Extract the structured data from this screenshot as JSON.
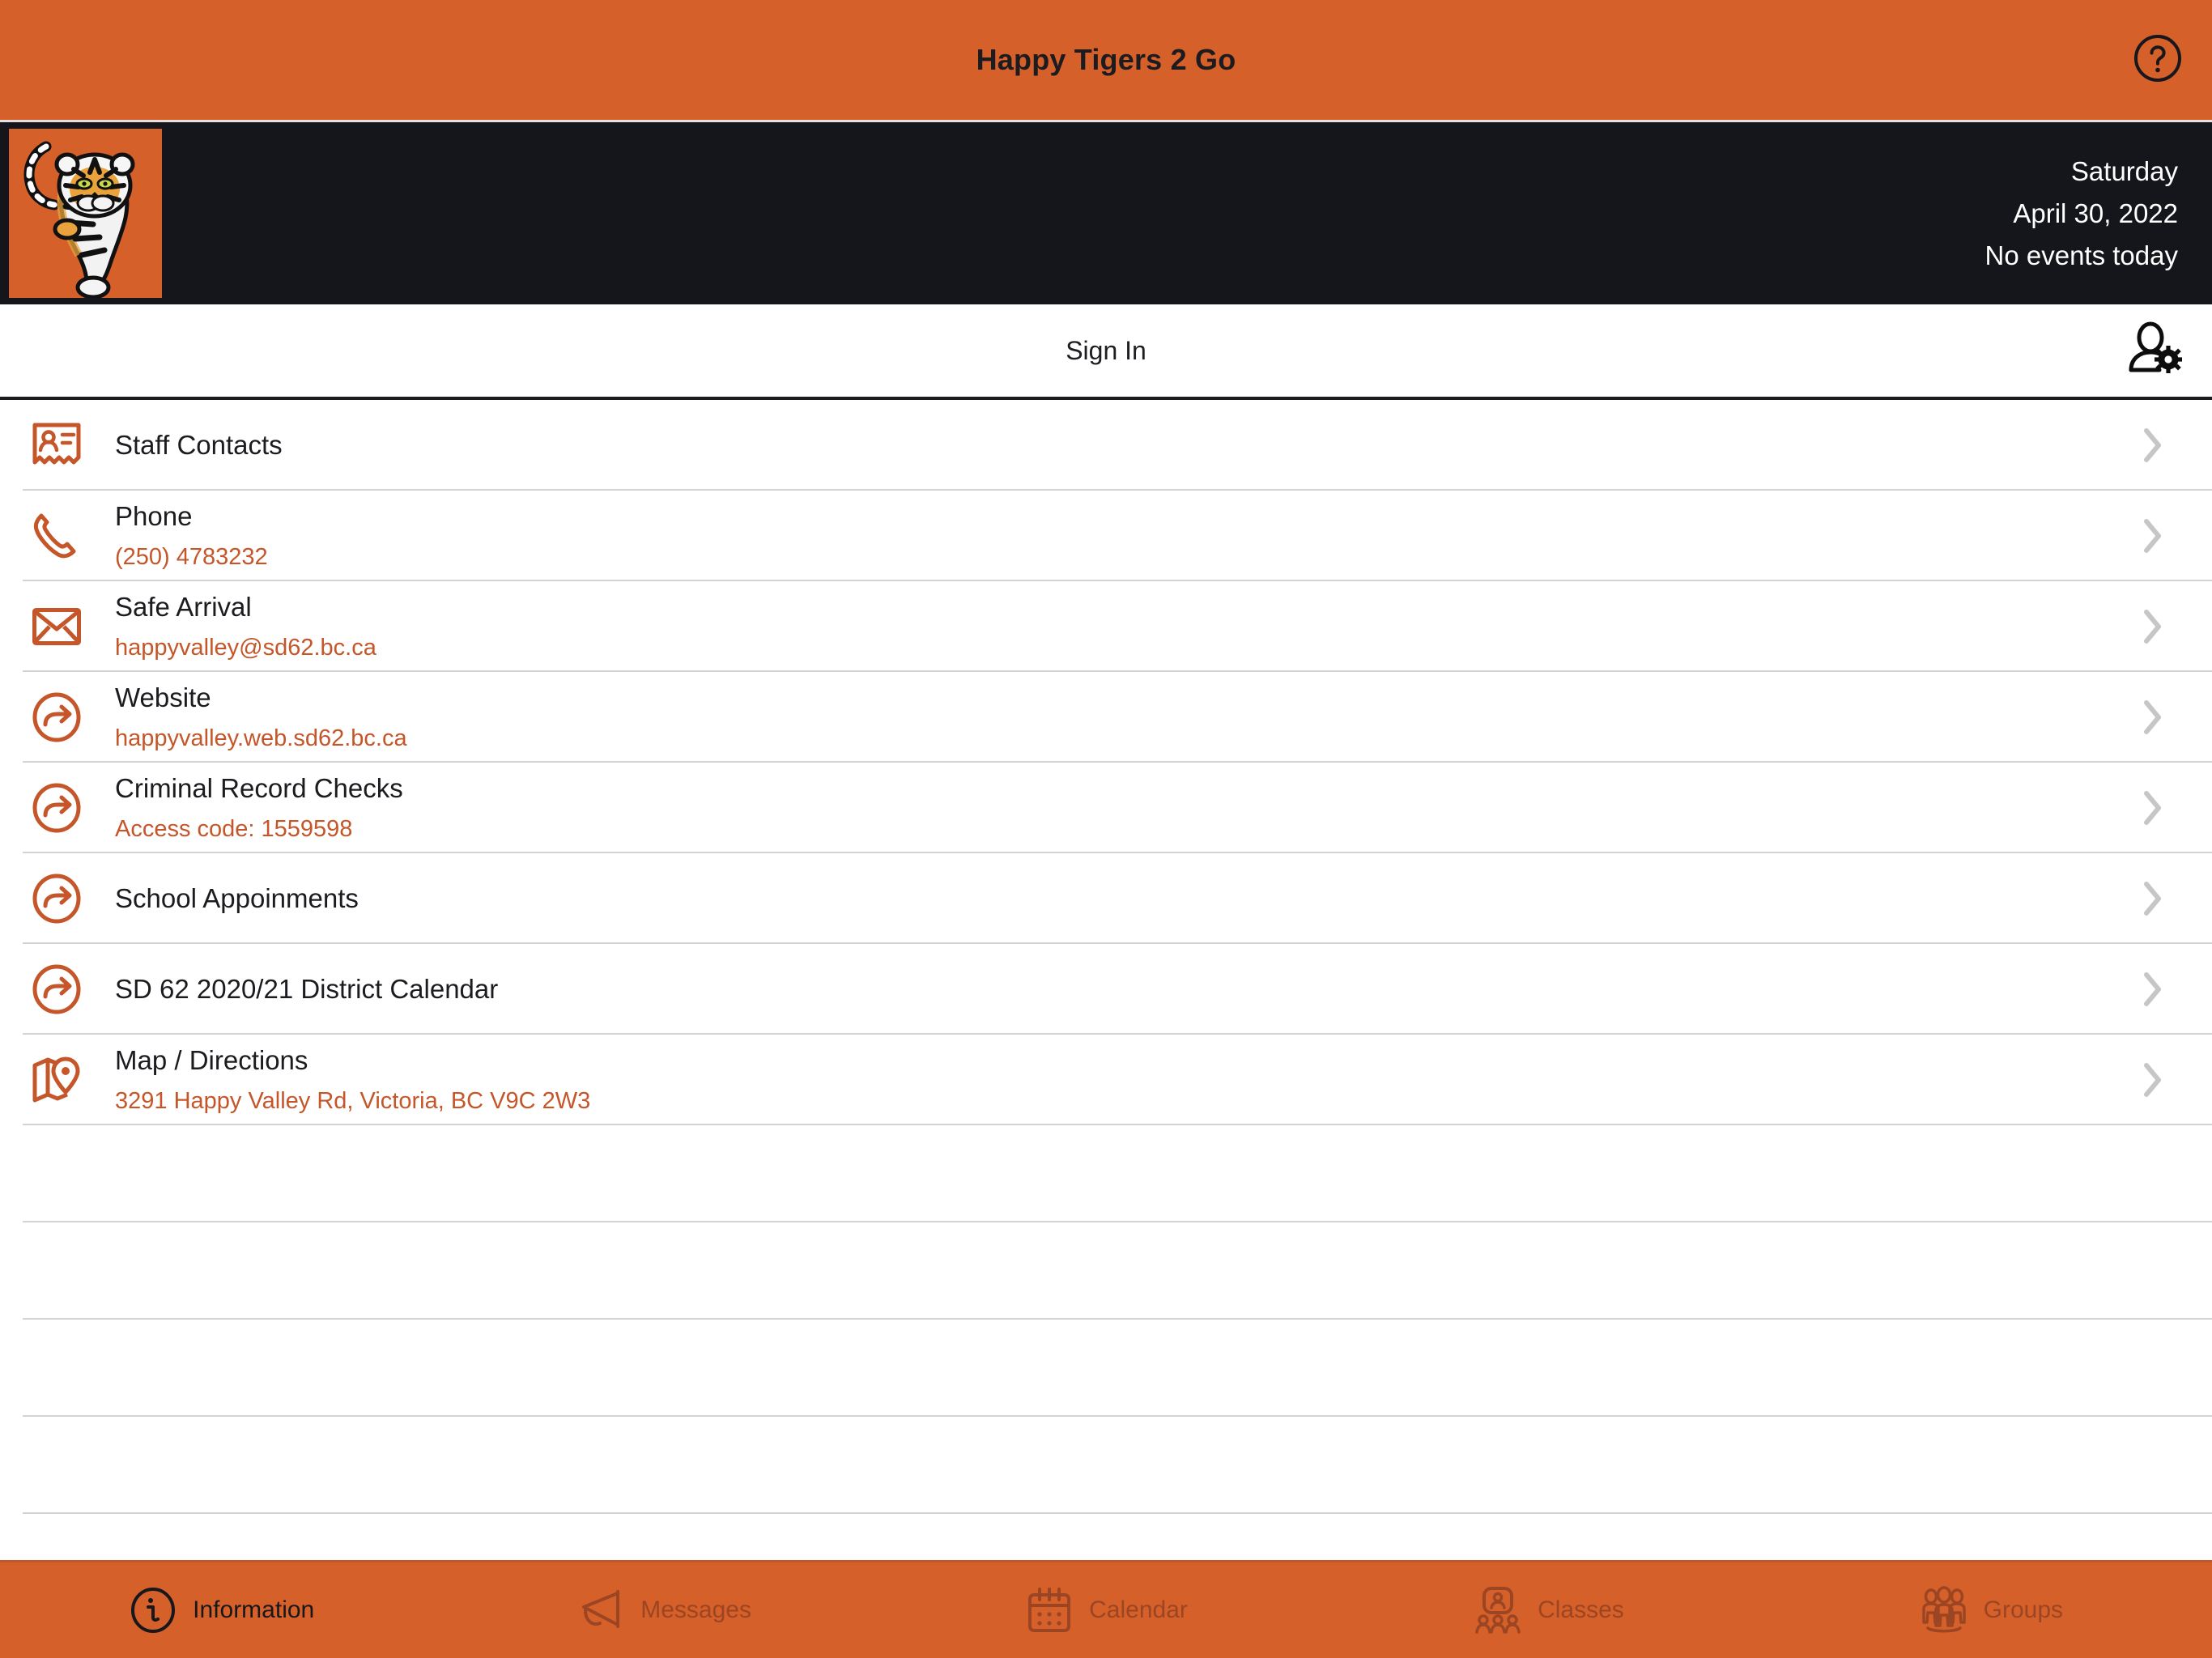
{
  "titlebar": {
    "title": "Happy Tigers 2 Go",
    "help_icon": "question-circle-icon"
  },
  "banner": {
    "logo_icon": "tiger-mascot-logo",
    "weekday": "Saturday",
    "date": "April 30, 2022",
    "events": "No events today"
  },
  "signin": {
    "label": "Sign In",
    "user_settings_icon": "user-settings-icon"
  },
  "colors": {
    "brand_orange": "#d5602a",
    "banner_dark": "#15151c",
    "link_orange": "#c4562a",
    "tab_inactive": "#9c4522",
    "separator": "#d3d3d3"
  },
  "list": {
    "rows": [
      {
        "icon": "contact-card-icon",
        "title": "Staff Contacts",
        "sub": ""
      },
      {
        "icon": "phone-icon",
        "title": "Phone",
        "sub": "(250) 4783232"
      },
      {
        "icon": "envelope-icon",
        "title": "Safe Arrival",
        "sub": "happyvalley@sd62.bc.ca"
      },
      {
        "icon": "external-link-icon",
        "title": "Website",
        "sub": "happyvalley.web.sd62.bc.ca"
      },
      {
        "icon": "external-link-icon",
        "title": "Criminal Record Checks",
        "sub": "Access code:  1559598"
      },
      {
        "icon": "external-link-icon",
        "title": "School Appoinments",
        "sub": ""
      },
      {
        "icon": "external-link-icon",
        "title": "SD 62 2020/21 District Calendar",
        "sub": ""
      },
      {
        "icon": "map-pin-icon",
        "title": "Map / Directions",
        "sub": "3291 Happy Valley Rd, Victoria, BC V9C 2W3"
      }
    ],
    "chevron_icon": "chevron-right-icon"
  },
  "tabbar": {
    "tabs": [
      {
        "label": "Information",
        "icon": "info-circle-icon",
        "active": true
      },
      {
        "label": "Messages",
        "icon": "megaphone-icon",
        "active": false
      },
      {
        "label": "Calendar",
        "icon": "calendar-icon",
        "active": false
      },
      {
        "label": "Classes",
        "icon": "classes-icon",
        "active": false
      },
      {
        "label": "Groups",
        "icon": "groups-icon",
        "active": false
      }
    ]
  }
}
